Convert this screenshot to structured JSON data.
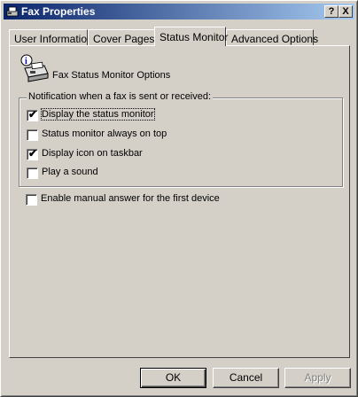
{
  "window": {
    "title": "Fax Properties",
    "help_label": "?",
    "close_label": "X"
  },
  "tabs": [
    {
      "label": "User Information"
    },
    {
      "label": "Cover Pages"
    },
    {
      "label": "Status Monitor"
    },
    {
      "label": "Advanced Options"
    }
  ],
  "panel": {
    "header_text": "Fax Status Monitor Options",
    "group_label": "Notification when a fax is sent or received:",
    "options": [
      {
        "label": "Display the status monitor",
        "checked": true
      },
      {
        "label": "Status monitor always on top",
        "checked": false
      },
      {
        "label": "Display icon on taskbar",
        "checked": true
      },
      {
        "label": "Play a sound",
        "checked": false
      }
    ],
    "manual_answer": {
      "label": "Enable manual answer for the first device",
      "checked": false
    }
  },
  "buttons": {
    "ok": "OK",
    "cancel": "Cancel",
    "apply": "Apply"
  },
  "check_glyph": "✔"
}
